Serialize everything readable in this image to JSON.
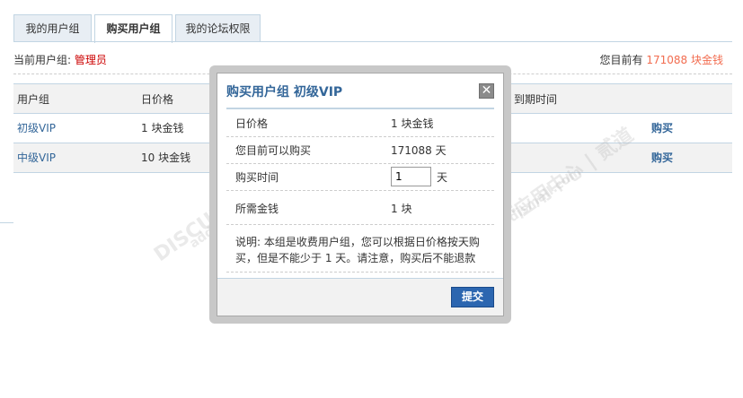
{
  "tabs": [
    {
      "label": "我的用户组"
    },
    {
      "label": "购买用户组"
    },
    {
      "label": "我的论坛权限"
    }
  ],
  "status": {
    "current_group_label": "当前用户组:",
    "current_group_value": "管理员",
    "balance_prefix": "您目前有",
    "balance_value": "171088 块金钱"
  },
  "table": {
    "headers": [
      "用户组",
      "日价格",
      "到期时间"
    ],
    "rows": [
      {
        "group": "初级VIP",
        "price": "1 块金钱",
        "action": "购买"
      },
      {
        "group": "中级VIP",
        "price": "10 块金钱",
        "action": "购买"
      }
    ]
  },
  "dialog": {
    "title": "购买用户组 初级VIP",
    "close_symbol": "✕",
    "rows": {
      "price_label": "日价格",
      "price_value": "1 块金钱",
      "can_buy_label": "您目前可以购买",
      "can_buy_value": "171088 天",
      "time_label": "购买时间",
      "time_value": "1",
      "time_unit": "天",
      "cost_label": "所需金钱",
      "cost_value": "1 块"
    },
    "note": "说明: 本组是收费用户组，您可以根据日价格按天购买，但是不能少于 1 天。请注意，购买后不能退款",
    "submit_label": "提交"
  },
  "watermark": {
    "brand": "DISCUZ!",
    "text": "应用中心 | 贰道",
    "url": "addon.discuz.com",
    "url2": "addon.dismall.com"
  },
  "colors": {
    "accent": "#336699",
    "red": "#cc0000",
    "orange": "#f26c4f",
    "submit": "#2c66b0"
  }
}
